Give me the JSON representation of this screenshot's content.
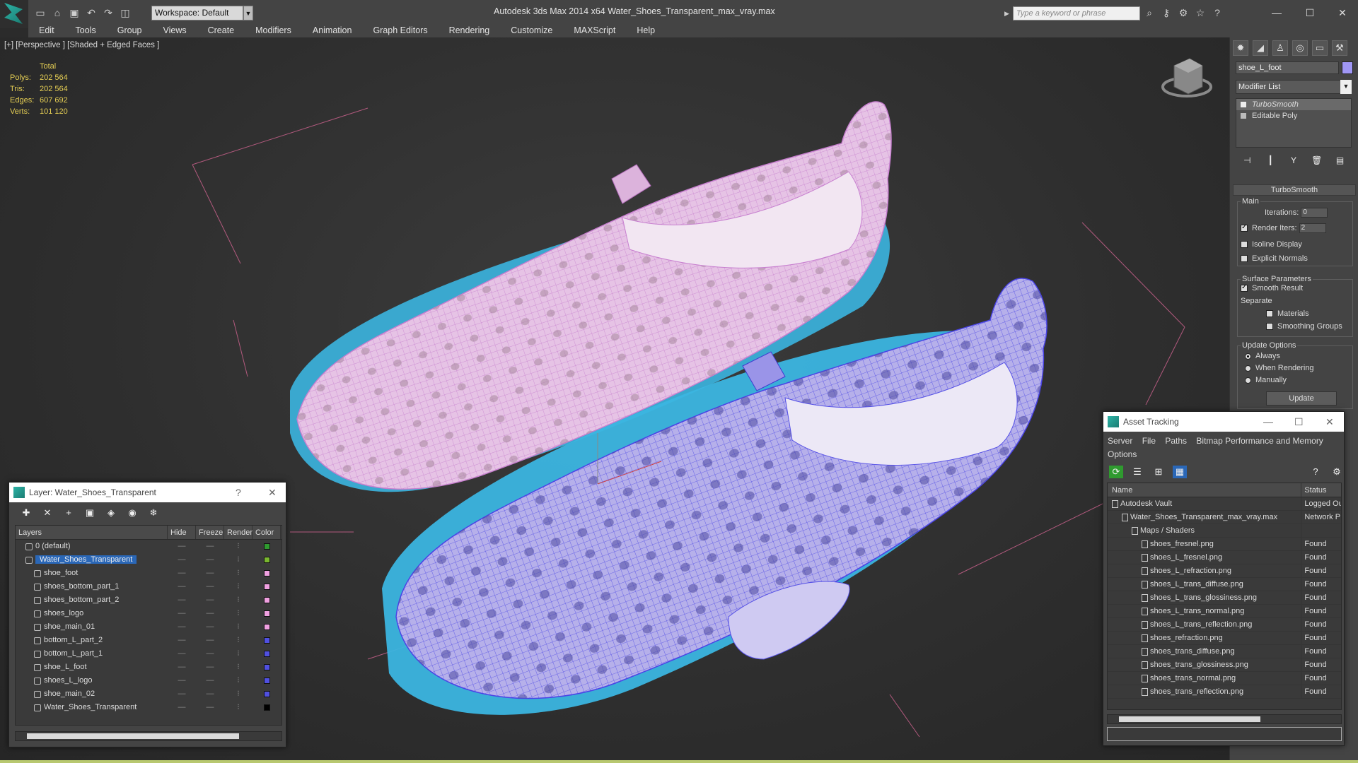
{
  "app": {
    "title": "Autodesk 3ds Max  2014 x64      Water_Shoes_Transparent_max_vray.max",
    "workspace": "Workspace: Default",
    "search_placeholder": "Type a keyword or phrase"
  },
  "menu": [
    "Edit",
    "Tools",
    "Group",
    "Views",
    "Create",
    "Modifiers",
    "Animation",
    "Graph Editors",
    "Rendering",
    "Customize",
    "MAXScript",
    "Help"
  ],
  "viewport": {
    "label": "[+] [Perspective ] [Shaded + Edged Faces ]",
    "stats": {
      "total_label": "Total",
      "polys_label": "Polys:",
      "polys": "202 564",
      "tris_label": "Tris:",
      "tris": "202 564",
      "edges_label": "Edges:",
      "edges": "607 692",
      "verts_label": "Verts:",
      "verts": "101 120"
    }
  },
  "command_panel": {
    "object_name": "shoe_L_foot",
    "object_color": "#a097f5",
    "modifier_list": "Modifier List",
    "stack": [
      "TurboSmooth",
      "Editable Poly"
    ],
    "rollout": "TurboSmooth",
    "main_label": "Main",
    "iterations_label": "Iterations:",
    "iterations": "0",
    "render_iters_label": "Render Iters:",
    "render_iters": "2",
    "isoline": "Isoline Display",
    "explicit_normals": "Explicit Normals",
    "surface_params": "Surface Parameters",
    "smooth_result": "Smooth Result",
    "separate": "Separate",
    "materials": "Materials",
    "smoothing_groups": "Smoothing Groups",
    "update_options": "Update Options",
    "always": "Always",
    "when_rendering": "When Rendering",
    "manually": "Manually",
    "update_button": "Update"
  },
  "layer_dialog": {
    "title": "Layer: Water_Shoes_Transparent",
    "help": "?",
    "columns": [
      "Layers",
      "Hide",
      "Freeze",
      "Render",
      "Color"
    ],
    "rows": [
      {
        "name": "0 (default)",
        "indent": 0,
        "color": "#2f9a2f"
      },
      {
        "name": "Water_Shoes_Transparent",
        "indent": 0,
        "color": "#7ab72f",
        "selected": true
      },
      {
        "name": "shoe_foot",
        "indent": 1,
        "color": "#f0a0e0"
      },
      {
        "name": "shoes_bottom_part_1",
        "indent": 1,
        "color": "#f0a0e0"
      },
      {
        "name": "shoes_bottom_part_2",
        "indent": 1,
        "color": "#f0a0e0"
      },
      {
        "name": "shoes_logo",
        "indent": 1,
        "color": "#f0a0e0"
      },
      {
        "name": "shoe_main_01",
        "indent": 1,
        "color": "#f0a0e0"
      },
      {
        "name": "bottom_L_part_2",
        "indent": 1,
        "color": "#5050e0"
      },
      {
        "name": "bottom_L_part_1",
        "indent": 1,
        "color": "#5050e0"
      },
      {
        "name": "shoe_L_foot",
        "indent": 1,
        "color": "#5050e0"
      },
      {
        "name": "shoes_L_logo",
        "indent": 1,
        "color": "#5050e0"
      },
      {
        "name": "shoe_main_02",
        "indent": 1,
        "color": "#5050e0"
      },
      {
        "name": "Water_Shoes_Transparent",
        "indent": 1,
        "color": "#000000"
      }
    ]
  },
  "asset_dialog": {
    "title": "Asset Tracking",
    "menu": [
      "Server",
      "File",
      "Paths",
      "Bitmap Performance and Memory",
      "Options"
    ],
    "columns": [
      "Name",
      "Status"
    ],
    "rows": [
      {
        "name": "Autodesk Vault",
        "status": "Logged Ou",
        "indent": 0
      },
      {
        "name": "Water_Shoes_Transparent_max_vray.max",
        "status": "Network P",
        "indent": 1
      },
      {
        "name": "Maps / Shaders",
        "status": "",
        "indent": 2
      },
      {
        "name": "shoes_fresnel.png",
        "status": "Found",
        "indent": 3
      },
      {
        "name": "shoes_L_fresnel.png",
        "status": "Found",
        "indent": 3
      },
      {
        "name": "shoes_L_refraction.png",
        "status": "Found",
        "indent": 3
      },
      {
        "name": "shoes_L_trans_diffuse.png",
        "status": "Found",
        "indent": 3
      },
      {
        "name": "shoes_L_trans_glossiness.png",
        "status": "Found",
        "indent": 3
      },
      {
        "name": "shoes_L_trans_normal.png",
        "status": "Found",
        "indent": 3
      },
      {
        "name": "shoes_L_trans_reflection.png",
        "status": "Found",
        "indent": 3
      },
      {
        "name": "shoes_refraction.png",
        "status": "Found",
        "indent": 3
      },
      {
        "name": "shoes_trans_diffuse.png",
        "status": "Found",
        "indent": 3
      },
      {
        "name": "shoes_trans_glossiness.png",
        "status": "Found",
        "indent": 3
      },
      {
        "name": "shoes_trans_normal.png",
        "status": "Found",
        "indent": 3
      },
      {
        "name": "shoes_trans_reflection.png",
        "status": "Found",
        "indent": 3
      }
    ]
  },
  "colors": {
    "pink_shoe": "#e8c0e6",
    "blue_shoe": "#8c86f0",
    "sole": "#3bb5e0"
  }
}
